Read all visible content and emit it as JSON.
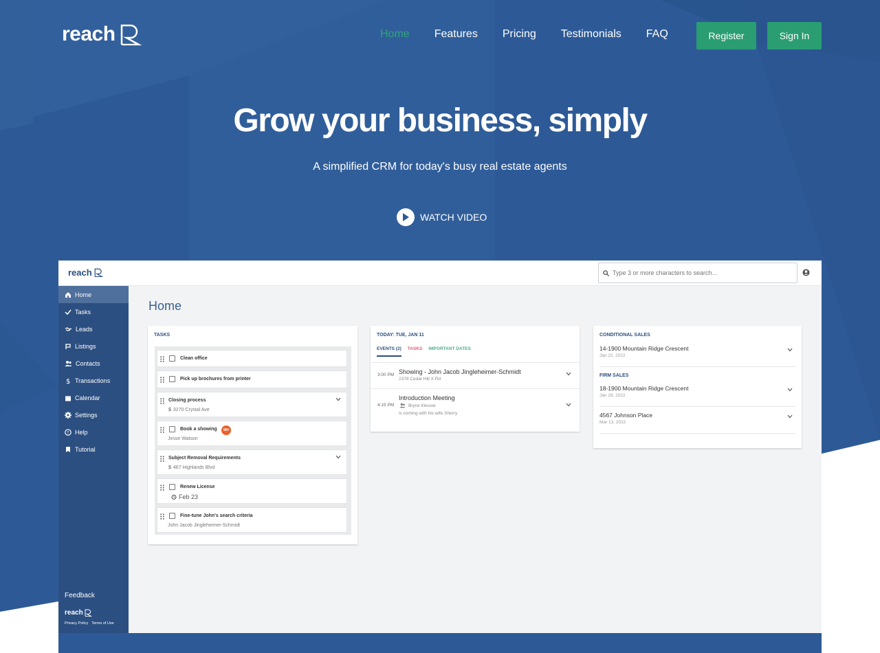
{
  "colors": {
    "hero_blue": "#2d5a97",
    "accent_green": "#2a9d72",
    "sidebar_blue": "#2c4f81",
    "badge_orange": "#e8622a",
    "tab_tasks_pink": "#e05b73",
    "tab_dates_green": "#4cae8f"
  },
  "nav": {
    "logo": "reach",
    "links": [
      "Home",
      "Features",
      "Pricing",
      "Testimonials",
      "FAQ"
    ],
    "active": "Home",
    "register": "Register",
    "signin": "Sign In"
  },
  "hero": {
    "title": "Grow your business, simply",
    "subtitle": "A simplified CRM for today's busy real estate agents",
    "watch": "WATCH VIDEO"
  },
  "app": {
    "logo": "reach",
    "search_placeholder": "Type 3 or more characters to search...",
    "sidebar": [
      {
        "label": "Home",
        "icon": "home-icon"
      },
      {
        "label": "Tasks",
        "icon": "check-icon"
      },
      {
        "label": "Leads",
        "icon": "handshake-icon"
      },
      {
        "label": "Listings",
        "icon": "sign-icon"
      },
      {
        "label": "Contacts",
        "icon": "people-icon"
      },
      {
        "label": "Transactions",
        "icon": "dollar-icon"
      },
      {
        "label": "Calendar",
        "icon": "calendar-icon"
      },
      {
        "label": "Settings",
        "icon": "gear-icon"
      },
      {
        "label": "Help",
        "icon": "help-icon"
      },
      {
        "label": "Tutorial",
        "icon": "bookmark-icon"
      }
    ],
    "feedback": "Feedback",
    "footer_logo": "reach",
    "privacy": "Privacy Policy",
    "terms": "Terms of Use",
    "page_title": "Home",
    "tasks": {
      "title": "TASKS",
      "items": [
        {
          "title": "Clean office",
          "sub": ""
        },
        {
          "title": "Pick up brochures from printer",
          "sub": ""
        },
        {
          "title": "Closing process",
          "sub": "3270 Crystal Ave"
        },
        {
          "title": "Book a showing",
          "sub": "Jesse Watson",
          "badge": "MH"
        },
        {
          "title": "Subject Removal Requirements",
          "sub": "467 Highlands Blvd"
        },
        {
          "title": "Renew License",
          "sub": "Feb 23"
        },
        {
          "title": "Fine-tune John's search criteria",
          "sub": "John Jacob Jingleheimer-Schmidt"
        }
      ]
    },
    "today": {
      "title": "TODAY: TUE, JAN 11",
      "tab_events": "EVENTS (2)",
      "tab_tasks": "TASKS",
      "tab_dates": "IMPORTANT DATES",
      "events": [
        {
          "time": "3:00 PM",
          "title": "Showing - John Jacob Jingleheimer-Schmidt",
          "sub": "2378 Cedar Hill X Rd"
        },
        {
          "time": "4:15 PM",
          "title": "Introduction Meeting",
          "sub": "Bryce Klesser",
          "note": "is coming with his wife Sherry"
        }
      ]
    },
    "sales": {
      "conditional_title": "CONDITIONAL SALES",
      "conditional": [
        {
          "title": "14-1900 Mountain Ridge Crescent",
          "date": "Jan 22, 2022"
        }
      ],
      "firm_title": "FIRM SALES",
      "firm": [
        {
          "title": "18-1900 Mountain Ridge Crescent",
          "date": "Jan 29, 2022"
        },
        {
          "title": "4567 Johnson Place",
          "date": "Mar 13, 2022"
        }
      ]
    }
  }
}
